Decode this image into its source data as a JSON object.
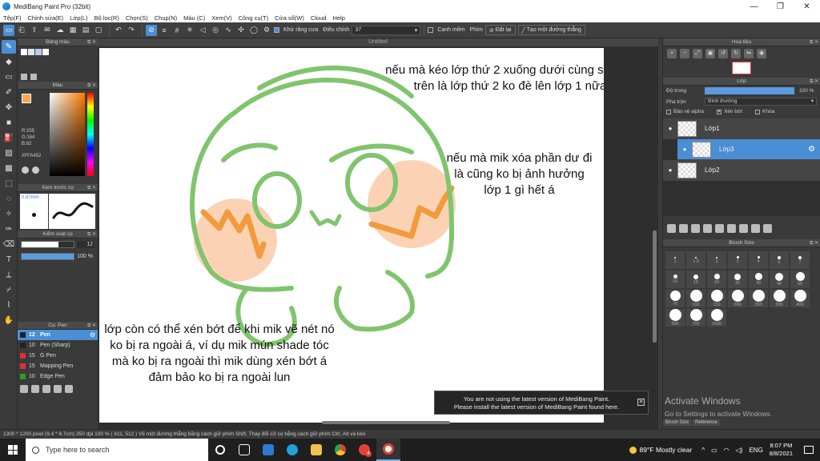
{
  "window": {
    "title": "MediBang Paint Pro (32bit)",
    "minimize": "—",
    "maximize": "❐",
    "close": "✕"
  },
  "menu": [
    "Tệp(F)",
    "Chỉnh sửa(E)",
    "Lớp(L)",
    "Bộ lọc(R)",
    "Chọn(S)",
    "Chụp(N)",
    "Màu (C)",
    "Xem(V)",
    "Công cụ(T)",
    "Cửa sổ(W)",
    "Cloud",
    "Help"
  ],
  "toolbar": {
    "antialias_label": "Khử răng cưa",
    "adjust_label": "Điều chỉnh",
    "adjust_value": "37",
    "snap_label": "Canh mềm",
    "pen_label": "Phím",
    "disable_label": "Đặt lại",
    "create_label": "Tạo một đường thẳng"
  },
  "left": {
    "palette_title": "Bảng màu",
    "palette_swatches": [
      "#ffffff",
      "#d9e7f7",
      "#b9cde8",
      "#ffffff"
    ],
    "color_title": "Màu",
    "rgb": [
      "R:255",
      "G:164",
      "B:82"
    ],
    "hex": "#FFA452",
    "fg_color": "#ffa452",
    "preview_title": "Xem trước cọ",
    "preview_size": "0.87mm",
    "control_title": "Kiểm soát cọ",
    "size_value": "12",
    "opacity_value": "100 %",
    "brush_title": "Cọ: Pen",
    "brushes": [
      {
        "size": "12",
        "name": "Pen",
        "color": "#222222",
        "active": true
      },
      {
        "size": "10",
        "name": "Pen (Sharp)",
        "color": "#222222",
        "active": false
      },
      {
        "size": "15",
        "name": "G Pen",
        "color": "#e03030",
        "active": false
      },
      {
        "size": "15",
        "name": "Mapping Pen",
        "color": "#e03030",
        "active": false
      },
      {
        "size": "10",
        "name": "Edge Pen",
        "color": "#2a9d2a",
        "active": false
      }
    ]
  },
  "canvas": {
    "tab": "Untitled",
    "note1": "nếu mà kéo lớp thứ 2 xuống dưới cùng sẽ như trên là lớp thứ 2 ko đè lên lớp 1 nữa",
    "note2": "nếu mà mik xóa phần dư đi là cũng ko bị ảnh hưởng lớp 1 gì hết á",
    "note3": "lớp còn có thể xén bớt để khi mik vẽ nét nó ko bị ra ngoài á, ví dụ mik mún shade tóc mà ko bị ra ngoài thì mik dùng xén bớt á đảm bảo ko bị ra ngoài lun",
    "line_color": "#80c46e",
    "blush_color": "#fbd3b4",
    "stroke_color": "#f29a3c"
  },
  "toast": {
    "line1": "You are not using the latest version of MediBang Paint.",
    "line2": "Please install the latest version of MediBang Paint found here.",
    "close": "✕"
  },
  "right": {
    "navigator_title": "Hoa tiêu",
    "layer_title": "Lớp",
    "opacity_label": "Độ trong",
    "opacity_value": "100 %",
    "blend_label": "Pha trộn",
    "blend_value": "Bình thường",
    "protect_alpha": "Bảo vệ alpha",
    "clipping": "Xén bớt",
    "lock": "Khóa",
    "layers": [
      {
        "name": "Lớp1",
        "active": false
      },
      {
        "name": "Lớp3",
        "active": true
      },
      {
        "name": "Lớp2",
        "active": false
      }
    ],
    "brush_size_title": "Brush Size",
    "brush_sizes": [
      "1",
      "1.5",
      "2",
      "3",
      "4",
      "5",
      "7",
      "10",
      "15",
      "20",
      "25",
      "30",
      "40",
      "50",
      "70",
      "100",
      "150",
      "200",
      "250",
      "300",
      "400",
      "500",
      "700",
      "1000"
    ],
    "activate_title": "Activate Windows",
    "activate_sub": "Go to Settings to activate Windows.",
    "tab1": "Brush Size",
    "tab2": "Reference"
  },
  "status": "1300 * 1200 pixel  (9.4 * 8.7cm)  350 dpi  100 %  ( 611, 512 )  Vẽ một đường thẳng bằng cách giữ phím Shift, Thay đổi cỡ cọ bằng cách giữ phím Ctrl, Alt và kéo",
  "taskbar": {
    "search_placeholder": "Type here to search",
    "weather": "89°F  Mostly clear",
    "lang": "ENG",
    "time": "8:07 PM",
    "date": "8/8/2021",
    "badge": "4"
  }
}
